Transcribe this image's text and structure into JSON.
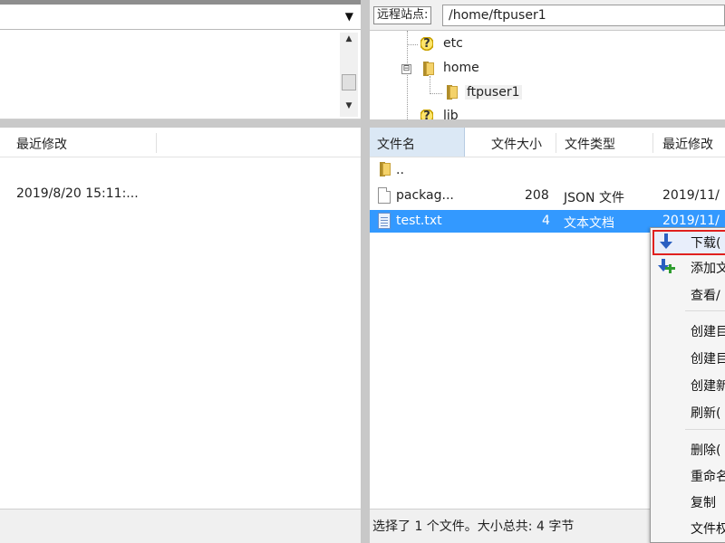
{
  "left_panel": {
    "column_headers": {
      "modified": "最近修改"
    },
    "rows": [
      {
        "modified": "2019/8/20 15:11:..."
      }
    ],
    "scrollbar": {
      "up": "▲",
      "down": "▼"
    },
    "combo_arrow": "▼"
  },
  "remote_site": {
    "label": "远程站点:",
    "path": "/home/ftpuser1"
  },
  "remote_tree": {
    "items": [
      {
        "name": "etc",
        "icon": "question-folder-icon"
      },
      {
        "name": "home",
        "icon": "folder-icon",
        "expander": "⊟"
      },
      {
        "name": "ftpuser1",
        "icon": "folder-icon"
      },
      {
        "name": "lib",
        "icon": "question-folder-icon"
      }
    ]
  },
  "file_list": {
    "columns": {
      "name": "文件名",
      "size": "文件大小",
      "type": "文件类型",
      "modified": "最近修改"
    },
    "rows": [
      {
        "name": "..",
        "size": "",
        "type": "",
        "modified": "",
        "icon": "folder-icon"
      },
      {
        "name": "packag...",
        "size": "208",
        "type": "JSON 文件",
        "modified": "2019/11/",
        "icon": "document-icon"
      },
      {
        "name": "test.txt",
        "size": "4",
        "type": "文本文档",
        "modified": "2019/11/",
        "icon": "text-file-icon",
        "selected": true
      }
    ],
    "status": "选择了 1 个文件。大小总共: 4 字节"
  },
  "context_menu": {
    "items": [
      {
        "label": "下载(",
        "icon": "download-icon",
        "highlighted": true
      },
      {
        "label": "添加文",
        "icon": "add-to-queue-icon"
      },
      {
        "label": "查看/"
      },
      {
        "label": "创建目"
      },
      {
        "label": "创建目"
      },
      {
        "label": "创建新"
      },
      {
        "label": "刷新("
      },
      {
        "label": "删除("
      },
      {
        "label": "重命名"
      },
      {
        "label": "复制"
      },
      {
        "label": "文件权"
      }
    ]
  },
  "colors": {
    "selection": "#3399ff",
    "highlight_border": "#e0201e",
    "splitter": "#c8c8c8",
    "download_arrow": "#2a5fc1",
    "add_plus": "#2f9d2f"
  }
}
